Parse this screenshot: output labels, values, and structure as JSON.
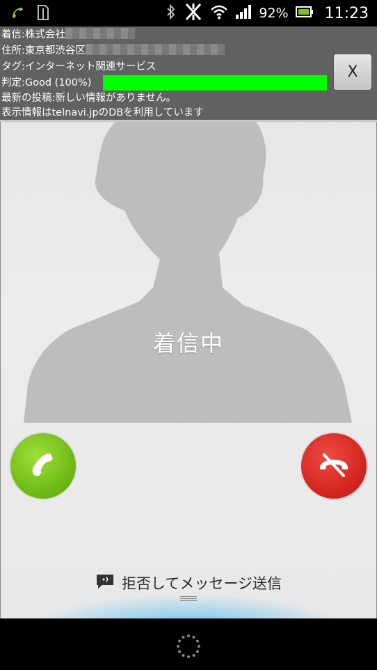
{
  "status_bar": {
    "battery_percent": "92%",
    "clock": "11:23",
    "icons": [
      "missed-call-icon",
      "sim-icon",
      "bluetooth-icon",
      "no-data-icon",
      "wifi-icon",
      "signal-icon",
      "battery-icon"
    ]
  },
  "caller_info": {
    "line1_prefix": "着信:株式会社",
    "line2_prefix": "住所:東京都渋谷区",
    "line3": "タグ:インターネット関連サービス",
    "line4": "判定:Good (100%)",
    "rating_percent": 100,
    "rating_color": "#00ff00",
    "line5": "最新の投稿:新しい情報がありません。",
    "line6": "表示情報はtelnavi.jpのDBを利用しています",
    "close_label": "X"
  },
  "call": {
    "status_text": "着信中",
    "answer_icon": "phone-icon",
    "answer_color": "#7ac51c",
    "decline_icon": "phone-hangup-icon",
    "decline_color": "#d9251f"
  },
  "reject_message": {
    "label": "拒否してメッセージ送信",
    "icon": "message-bubble-icon"
  },
  "nav_bar": {
    "icon": "loading-spinner-icon"
  }
}
